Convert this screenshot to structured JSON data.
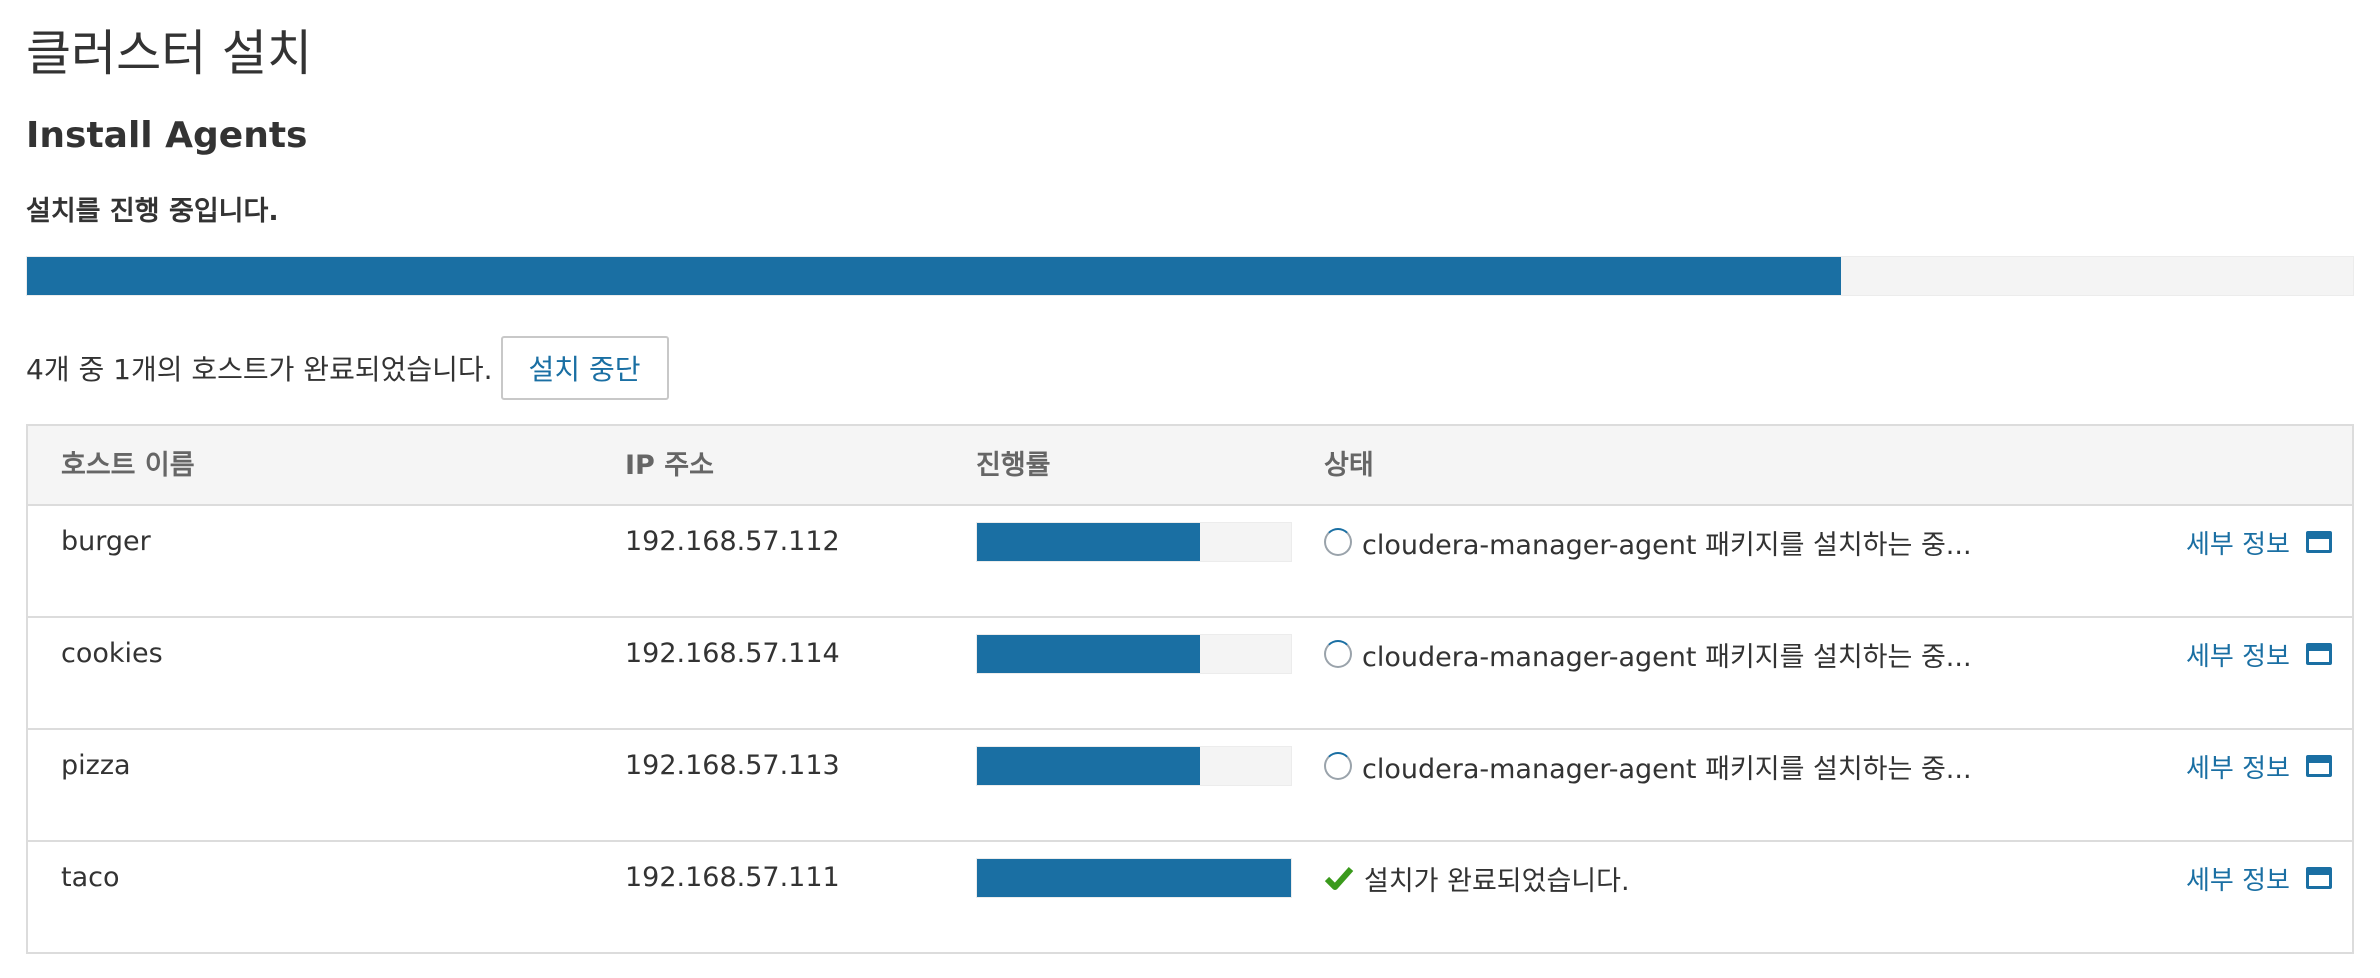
{
  "page": {
    "title": "클러스터 설치",
    "step_title": "Install Agents",
    "status": "설치를 진행 중입니다.",
    "overall_progress": 0.78,
    "summary": "4개 중 1개의 호스트가 완료되었습니다.",
    "abort_label": "설치 중단"
  },
  "table": {
    "headers": {
      "host": "호스트 이름",
      "ip": "IP 주소",
      "progress": "진행률",
      "status": "상태"
    },
    "rows": [
      {
        "host": "burger",
        "ip": "192.168.57.112",
        "progress": 0.71,
        "status_icon": "spinner-icon",
        "status": "cloudera-manager-agent 패키지를 설치하는 중...",
        "details": "세부 정보"
      },
      {
        "host": "cookies",
        "ip": "192.168.57.114",
        "progress": 0.71,
        "status_icon": "spinner-icon",
        "status": "cloudera-manager-agent 패키지를 설치하는 중...",
        "details": "세부 정보"
      },
      {
        "host": "pizza",
        "ip": "192.168.57.113",
        "progress": 0.71,
        "status_icon": "spinner-icon",
        "status": "cloudera-manager-agent 패키지를 설치하는 중...",
        "details": "세부 정보"
      },
      {
        "host": "taco",
        "ip": "192.168.57.111",
        "progress": 1.0,
        "status_icon": "check-icon",
        "status": "설치가 완료되었습니다.",
        "details": "세부 정보"
      }
    ]
  },
  "colors": {
    "accent": "#1a6fa3",
    "success": "#3a9a1c"
  }
}
